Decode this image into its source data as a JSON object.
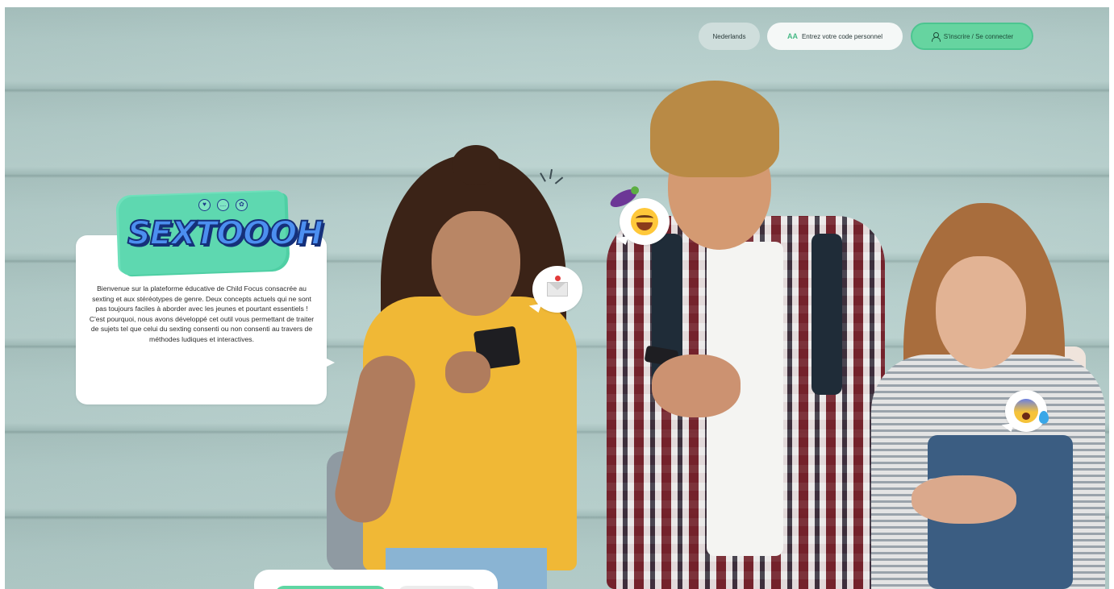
{
  "nav": {
    "language": "Nederlands",
    "code_icon": "AA",
    "code_label": "Entrez votre code personnel",
    "login_label": "S'inscrire / Se connecter",
    "login_icon": "user-icon",
    "accent_color": "#66d4a0"
  },
  "brand": {
    "logo_text": "SEXTOOOH",
    "logo_icons": [
      "heart-icon",
      "chat-icon",
      "flower-icon"
    ]
  },
  "intro": {
    "text": "Bienvenue sur la plateforme éducative de Child Focus consacrée au sexting et aux stéréotypes de genre. Deux concepts actuels qui ne sont pas toujours faciles à aborder avec les jeunes et pourtant essentiels ! C'est pourquoi, nous avons développé cet outil vous permettant de traiter de sujets tel que celui du sexting consenti ou non consenti au travers de méthodes ludiques et interactives."
  },
  "hero": {
    "emojis": [
      "mail-icon",
      "laughing-emoji",
      "eggplant-emoji",
      "scared-emoji"
    ]
  },
  "colors": {
    "wall": "#b2cdca",
    "logo_green": "#5ed8b0",
    "logo_blue": "#4c8ff0"
  }
}
